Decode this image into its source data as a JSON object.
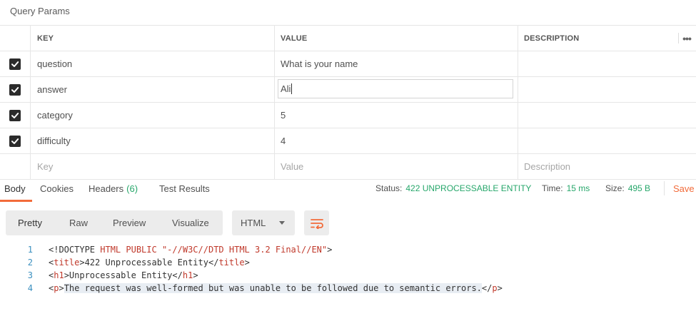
{
  "query_params": {
    "title": "Query Params",
    "headers": {
      "key": "KEY",
      "value": "VALUE",
      "description": "DESCRIPTION"
    },
    "rows": [
      {
        "checked": true,
        "key": "question",
        "value": "What is your name",
        "description": ""
      },
      {
        "checked": true,
        "key": "answer",
        "value": "Ali",
        "description": ""
      },
      {
        "checked": true,
        "key": "category",
        "value": "5",
        "description": ""
      },
      {
        "checked": true,
        "key": "difficulty",
        "value": "4",
        "description": ""
      }
    ],
    "new_row": {
      "key_placeholder": "Key",
      "value_placeholder": "Value",
      "description_placeholder": "Description"
    }
  },
  "response": {
    "tabs": [
      {
        "label": "Body",
        "active": true
      },
      {
        "label": "Cookies"
      },
      {
        "label": "Headers",
        "count": "(6)"
      },
      {
        "label": "Test Results"
      }
    ],
    "status_label": "Status:",
    "status_value": "422 UNPROCESSABLE ENTITY",
    "time_label": "Time:",
    "time_value": "15 ms",
    "size_label": "Size:",
    "size_value": "495 B",
    "save_label": "Save"
  },
  "view": {
    "modes": [
      "Pretty",
      "Raw",
      "Preview",
      "Visualize"
    ],
    "selected_mode": "Pretty",
    "format": "HTML"
  },
  "code_lines": [
    {
      "num": "1",
      "parts": [
        [
          "txt",
          "<!DOCTYPE "
        ],
        [
          "tag",
          "HTML PUBLIC \"-//W3C//DTD HTML 3.2 Final//EN\""
        ],
        [
          "txt",
          ">"
        ]
      ]
    },
    {
      "num": "2",
      "parts": [
        [
          "txt",
          "<"
        ],
        [
          "tag",
          "title"
        ],
        [
          "txt",
          ">422 Unprocessable Entity</"
        ],
        [
          "tag",
          "title"
        ],
        [
          "txt",
          ">"
        ]
      ]
    },
    {
      "num": "3",
      "parts": [
        [
          "txt",
          "<"
        ],
        [
          "tag",
          "h1"
        ],
        [
          "txt",
          ">Unprocessable Entity</"
        ],
        [
          "tag",
          "h1"
        ],
        [
          "txt",
          ">"
        ]
      ]
    },
    {
      "num": "4",
      "parts": [
        [
          "txt",
          "<"
        ],
        [
          "tag",
          "p"
        ],
        [
          "txt",
          ">"
        ],
        [
          "hl",
          "The request was well-formed but was unable to be followed due to semantic errors."
        ],
        [
          "txt",
          "</"
        ],
        [
          "tag",
          "p"
        ],
        [
          "txt",
          ">"
        ]
      ]
    }
  ],
  "colors": {
    "accent": "#f26b3a",
    "success": "#27a76b",
    "line_number": "#3a8fbf",
    "tag": "#c0392b"
  }
}
